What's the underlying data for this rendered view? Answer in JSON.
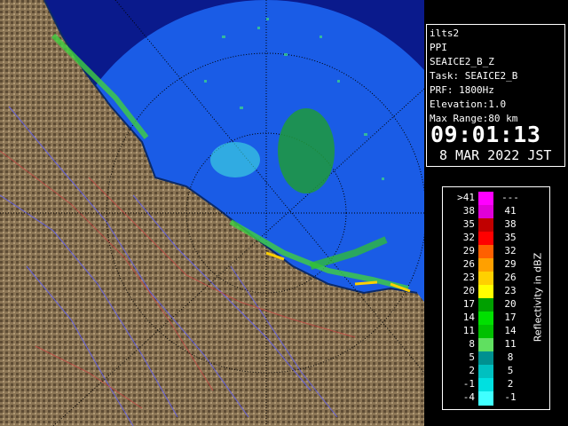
{
  "info": {
    "site": "ilts2",
    "product": "PPI",
    "data_name": "SEAICE2_B_Z",
    "task": "Task: SEAICE2_B",
    "prf": "PRF: 1800Hz",
    "elevation": "Elevation:1.0",
    "max_range": "Max Range:80 km",
    "time": "09:01:13",
    "date": "8 MAR 2022 JST"
  },
  "legend": {
    "title": "Reflectivity in dBZ",
    "rows": [
      {
        "lo": ">41",
        "hi": "---",
        "color": "#ff00ff"
      },
      {
        "lo": "38",
        "hi": "41",
        "color": "#e000d8"
      },
      {
        "lo": "35",
        "hi": "38",
        "color": "#c00000"
      },
      {
        "lo": "32",
        "hi": "35",
        "color": "#ff0000"
      },
      {
        "lo": "29",
        "hi": "32",
        "color": "#ff6000"
      },
      {
        "lo": "26",
        "hi": "29",
        "color": "#ffa000"
      },
      {
        "lo": "23",
        "hi": "26",
        "color": "#ffd000"
      },
      {
        "lo": "20",
        "hi": "23",
        "color": "#ffff00"
      },
      {
        "lo": "17",
        "hi": "20",
        "color": "#00a000"
      },
      {
        "lo": "14",
        "hi": "17",
        "color": "#00e000"
      },
      {
        "lo": "11",
        "hi": "14",
        "color": "#00c000"
      },
      {
        "lo": "8",
        "hi": "11",
        "color": "#60e060"
      },
      {
        "lo": "5",
        "hi": "8",
        "color": "#009090"
      },
      {
        "lo": "2",
        "hi": "5",
        "color": "#00c0c0"
      },
      {
        "lo": "-1",
        "hi": "2",
        "color": "#00e0e0"
      },
      {
        "lo": "-4",
        "hi": "-1",
        "color": "#40ffff"
      }
    ]
  },
  "colors": {
    "sea": "#1a5ce6",
    "outer_sea": "#0a1a8c",
    "land": "#8a7656",
    "coast": "#0a2a6a"
  }
}
